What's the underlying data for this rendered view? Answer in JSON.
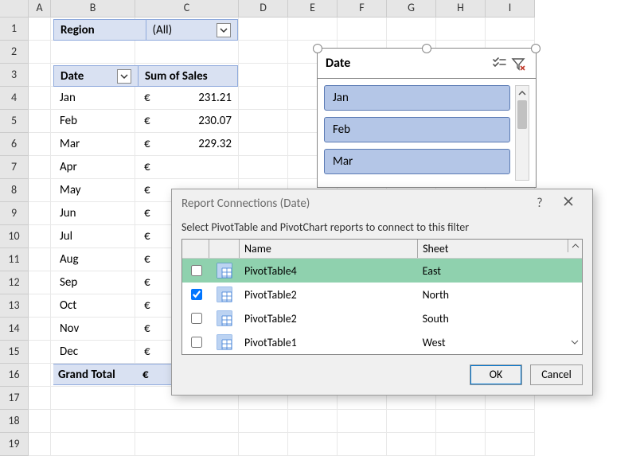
{
  "columns": [
    "A",
    "B",
    "C",
    "D",
    "E",
    "F",
    "G",
    "H",
    "I"
  ],
  "row_numbers": [
    1,
    2,
    3,
    4,
    5,
    6,
    7,
    8,
    9,
    10,
    11,
    12,
    13,
    14,
    15,
    16,
    17,
    18,
    19
  ],
  "pivot": {
    "filter_label": "Region",
    "filter_value": "(All)",
    "headers": {
      "date": "Date",
      "sales": "Sum of Sales"
    },
    "currency": "€",
    "rows": [
      {
        "label": "Jan",
        "value": "231.21"
      },
      {
        "label": "Feb",
        "value": "230.07"
      },
      {
        "label": "Mar",
        "value": "229.32"
      },
      {
        "label": "Apr",
        "value": ""
      },
      {
        "label": "May",
        "value": ""
      },
      {
        "label": "Jun",
        "value": ""
      },
      {
        "label": "Jul",
        "value": ""
      },
      {
        "label": "Aug",
        "value": ""
      },
      {
        "label": "Sep",
        "value": ""
      },
      {
        "label": "Oct",
        "value": ""
      },
      {
        "label": "Nov",
        "value": ""
      },
      {
        "label": "Dec",
        "value": ""
      }
    ],
    "grand_total_label": "Grand Total",
    "grand_total_value": ""
  },
  "slicer": {
    "title": "Date",
    "items": [
      "Jan",
      "Feb",
      "Mar"
    ]
  },
  "dialog": {
    "title": "Report Connections (Date)",
    "instruction": "Select PivotTable and PivotChart reports to connect to this filter",
    "headers": {
      "name": "Name",
      "sheet": "Sheet"
    },
    "rows": [
      {
        "checked": false,
        "name": "PivotTable4",
        "sheet": "East",
        "selected": true
      },
      {
        "checked": true,
        "name": "PivotTable2",
        "sheet": "North",
        "selected": false
      },
      {
        "checked": false,
        "name": "PivotTable2",
        "sheet": "South",
        "selected": false
      },
      {
        "checked": false,
        "name": "PivotTable1",
        "sheet": "West",
        "selected": false
      }
    ],
    "ok": "OK",
    "cancel": "Cancel"
  }
}
